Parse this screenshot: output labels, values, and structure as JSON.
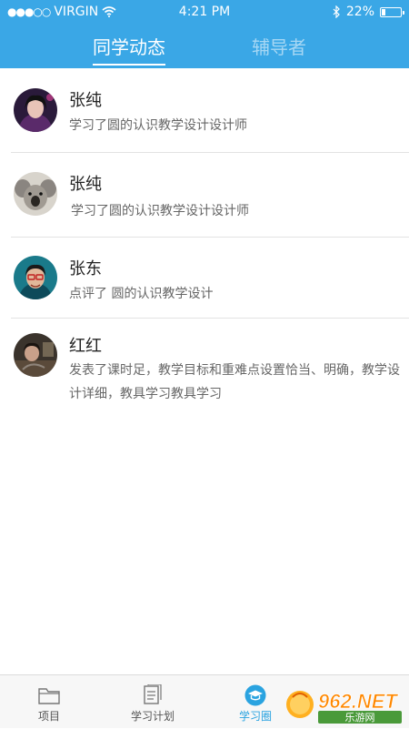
{
  "status_bar": {
    "carrier": "VIRGIN",
    "time": "4:21 PM",
    "battery": "22%",
    "battery_level": 0.22,
    "icons": [
      "signal-dots-icon",
      "wifi-icon",
      "bluetooth-icon",
      "battery-icon"
    ]
  },
  "header": {
    "tabs": [
      {
        "label": "同学动态",
        "active": true
      },
      {
        "label": "辅导者",
        "active": false
      }
    ],
    "color": "#3aa7e6"
  },
  "feed": [
    {
      "name": "张纯",
      "text": "学习了圆的认识教学设计设计师"
    },
    {
      "name": "张纯",
      "text": "学习了圆的认识教学设计设计师"
    },
    {
      "name": "张东",
      "text": "点评了  圆的认识教学设计"
    },
    {
      "name": "红红",
      "text": "发表了课时足，教学目标和重难点设置恰当、明确，教学设计详细，教具学习教具学习"
    }
  ],
  "tabbar": {
    "items": [
      {
        "label": "项目",
        "icon": "folder-icon"
      },
      {
        "label": "学习计划",
        "icon": "document-icon"
      },
      {
        "label": "学习圈",
        "icon": "graduation-cap-icon",
        "active": true
      }
    ],
    "active_color": "#2aa3e0"
  },
  "watermark": {
    "brand": "962.NET",
    "subtitle": "乐游网"
  }
}
